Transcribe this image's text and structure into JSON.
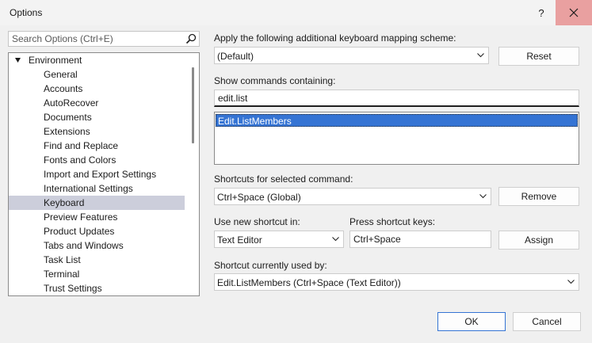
{
  "window": {
    "title": "Options",
    "help_label": "?"
  },
  "search": {
    "placeholder": "Search Options (Ctrl+E)"
  },
  "tree": {
    "root": "Environment",
    "items": [
      "General",
      "Accounts",
      "AutoRecover",
      "Documents",
      "Extensions",
      "Find and Replace",
      "Fonts and Colors",
      "Import and Export Settings",
      "International Settings",
      "Keyboard",
      "Preview Features",
      "Product Updates",
      "Tabs and Windows",
      "Task List",
      "Terminal",
      "Trust Settings"
    ],
    "selected": "Keyboard"
  },
  "keyboard": {
    "mapping_label": "Apply the following additional keyboard mapping scheme:",
    "mapping_value": "(Default)",
    "reset_label": "Reset",
    "show_commands_label": "Show commands containing:",
    "show_commands_value": "edit.list",
    "commands": [
      "Edit.ListMembers"
    ],
    "shortcuts_label": "Shortcuts for selected command:",
    "shortcuts_value": "Ctrl+Space (Global)",
    "remove_label": "Remove",
    "use_in_label": "Use new shortcut in:",
    "use_in_value": "Text Editor",
    "press_keys_label": "Press shortcut keys:",
    "press_keys_value": "Ctrl+Space",
    "assign_label": "Assign",
    "used_by_label": "Shortcut currently used by:",
    "used_by_value": "Edit.ListMembers (Ctrl+Space (Text Editor))"
  },
  "footer": {
    "ok_label": "OK",
    "cancel_label": "Cancel"
  },
  "colors": {
    "selection": "#3574d4",
    "tree_selection": "#cccedb",
    "close_hover": "#e9a0a0"
  }
}
